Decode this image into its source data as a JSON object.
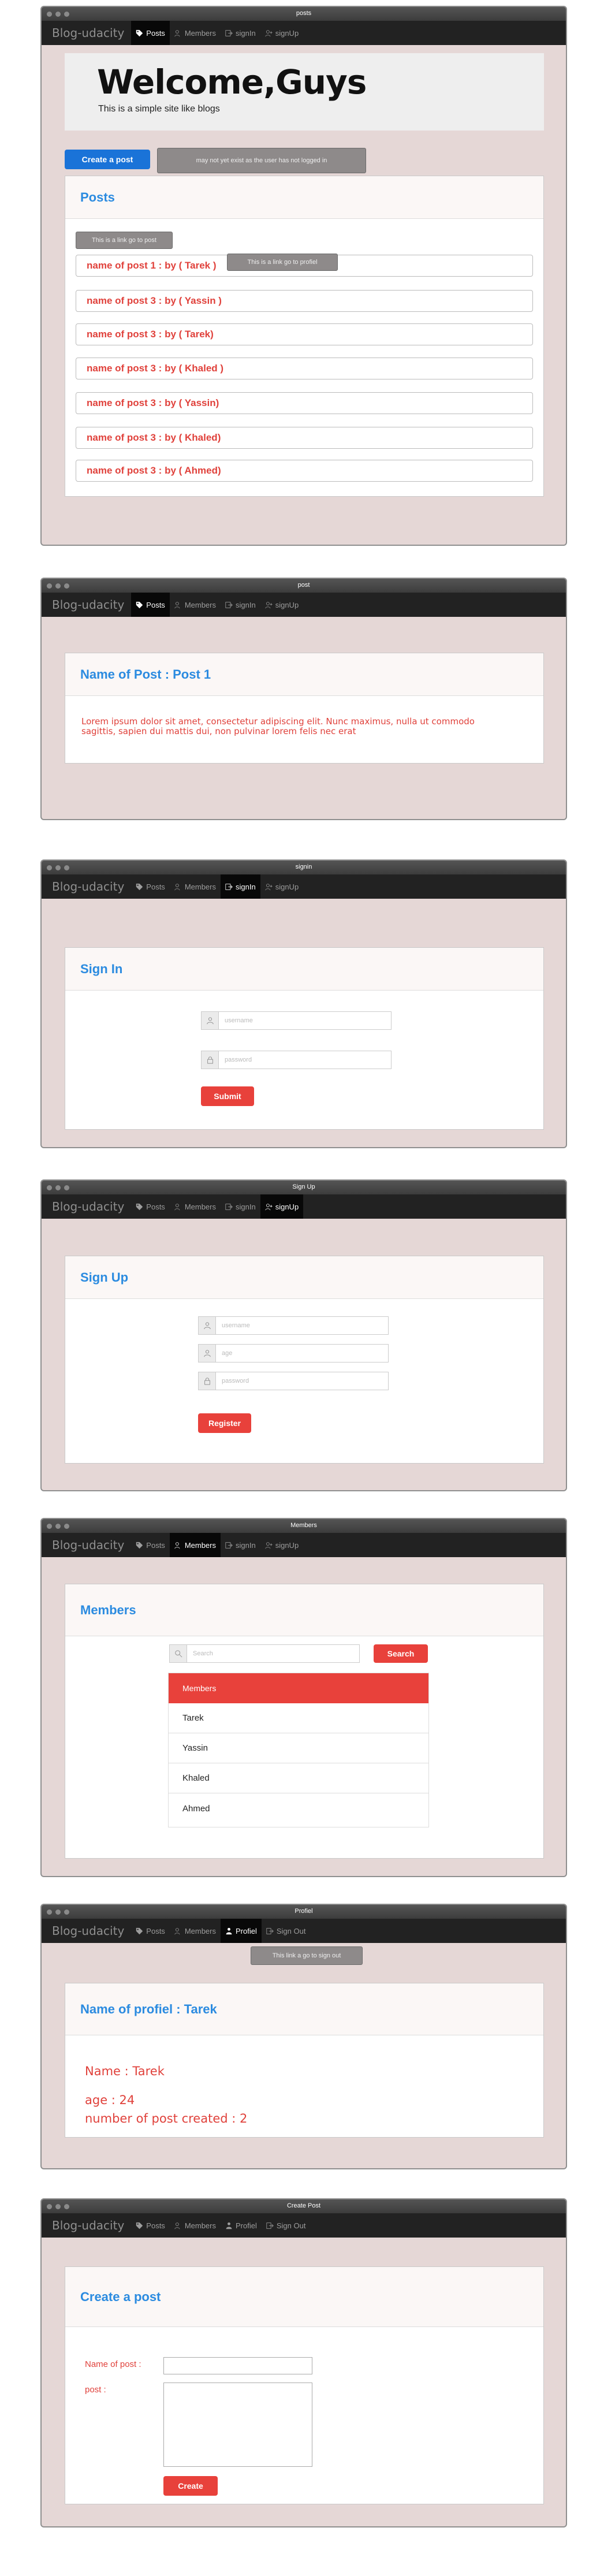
{
  "nav": {
    "brand": "Blog-udacity",
    "posts": "Posts",
    "members": "Members",
    "signin": "signIn",
    "signup": "signUp",
    "profiel": "Profiel",
    "signout": "Sign Out"
  },
  "windows": {
    "posts": {
      "title": "posts"
    },
    "post": {
      "title": "post"
    },
    "signin": {
      "title": "signin"
    },
    "signup": {
      "title": "Sign Up"
    },
    "members": {
      "title": "Members"
    },
    "profiel": {
      "title": "Profiel"
    },
    "create": {
      "title": "Create Post"
    }
  },
  "home": {
    "heading": "Welcome,Guys",
    "subheading": "This is a simple site like blogs",
    "create_button": "Create a post",
    "create_tooltip": "may not yet exist as the user has not logged in",
    "panel_title": "Posts",
    "link_tooltip": "This is a link go to post",
    "profile_tooltip": "This is a link go to profiel",
    "posts": [
      "name of post 1 : by ( Tarek )",
      "name of post 3 : by ( Yassin )",
      "name of post 3 : by ( Tarek)",
      "name of post 3 : by ( Khaled )",
      "name of post 3 : by ( Yassin)",
      "name of post 3 : by ( Khaled)",
      "name of post 3 : by ( Ahmed)"
    ]
  },
  "post_page": {
    "title": "Name of Post : Post 1",
    "body": "Lorem ipsum dolor sit amet, consectetur adipiscing elit. Nunc maximus, nulla ut commodo sagittis, sapien dui mattis dui, non pulvinar lorem felis nec erat"
  },
  "signin_page": {
    "title": "Sign In",
    "username_placeholder": "username",
    "password_placeholder": "password",
    "submit": "Submit"
  },
  "signup_page": {
    "title": "Sign Up",
    "username_placeholder": "username",
    "age_placeholder": "age",
    "password_placeholder": "password",
    "register": "Register"
  },
  "members_page": {
    "title": "Members",
    "search_placeholder": "Search",
    "search_button": "Search",
    "list_header": "Members",
    "members": [
      "Tarek",
      "Yassin",
      "Khaled",
      "Ahmed"
    ]
  },
  "profiel_page": {
    "signout_tooltip": "This link a go to sign out",
    "title": "Name of profiel : Tarek",
    "name": "Name : Tarek",
    "age": "age : 24",
    "count": "number of post created : 2"
  },
  "create_page": {
    "title": "Create a post",
    "name_label": "Name of post :",
    "post_label": "post :",
    "create_button": "Create"
  },
  "colors": {
    "accent_blue": "#2b8be0",
    "button_blue": "#1a73d8",
    "accent_red": "#e8413b",
    "window_bg": "#e5d7d6",
    "navbar_bg": "#222222"
  }
}
